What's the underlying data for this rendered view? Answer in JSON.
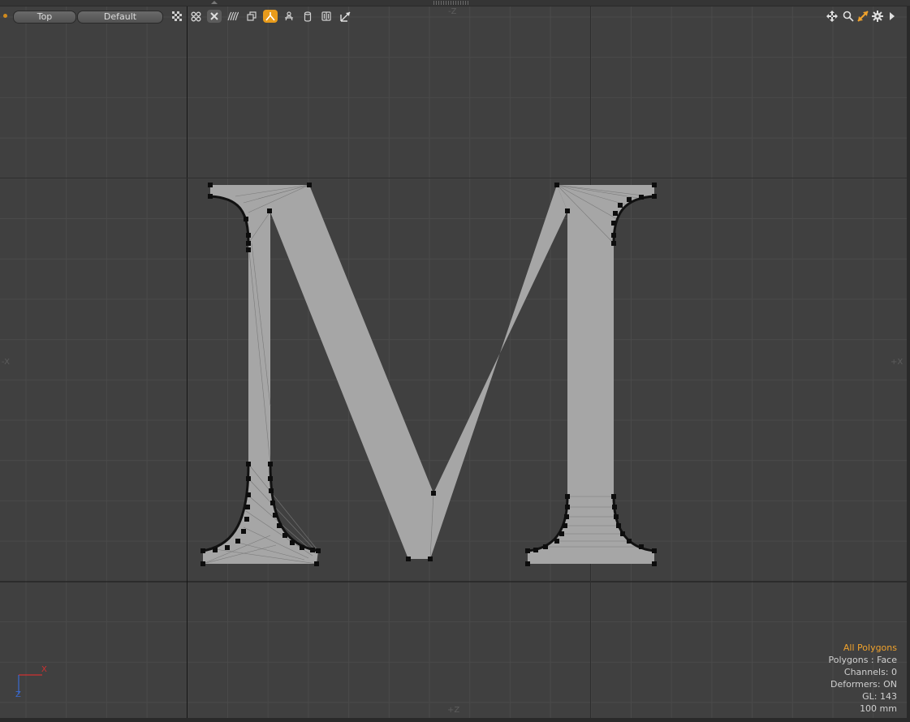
{
  "toolbar": {
    "view_label": "Top",
    "shading_label": "Default",
    "icons": [
      "checker-icon",
      "render-icon",
      "close-x-icon",
      "wave-icon",
      "layers-icon",
      "symmetry-icon",
      "person-icon",
      "cylinder-icon",
      "book-icon",
      "measure-icon"
    ],
    "active_icon": "symmetry-icon"
  },
  "navigation": {
    "icons": [
      "move-view-icon",
      "zoom-icon",
      "fit-view-icon",
      "gear-icon",
      "expand-arrow-icon"
    ]
  },
  "axes": {
    "top": "-Z",
    "bottom": "+Z",
    "left": "-X",
    "right": "+X",
    "gizmo_x": "X",
    "gizmo_z": "Z"
  },
  "info": {
    "mode": "All Polygons",
    "polygons": "Polygons : Face",
    "channels": "Channels: 0",
    "deformers": "Deformers: ON",
    "gl": "GL: 143",
    "scale": "100 mm"
  },
  "colors": {
    "viewport_bg": "#404040",
    "grid": "#4a4a4a",
    "polygon_fill": "#a6a6a6",
    "accent": "#f0a22c",
    "gizmo_x": "#d03030",
    "gizmo_z": "#3a6ad0"
  }
}
